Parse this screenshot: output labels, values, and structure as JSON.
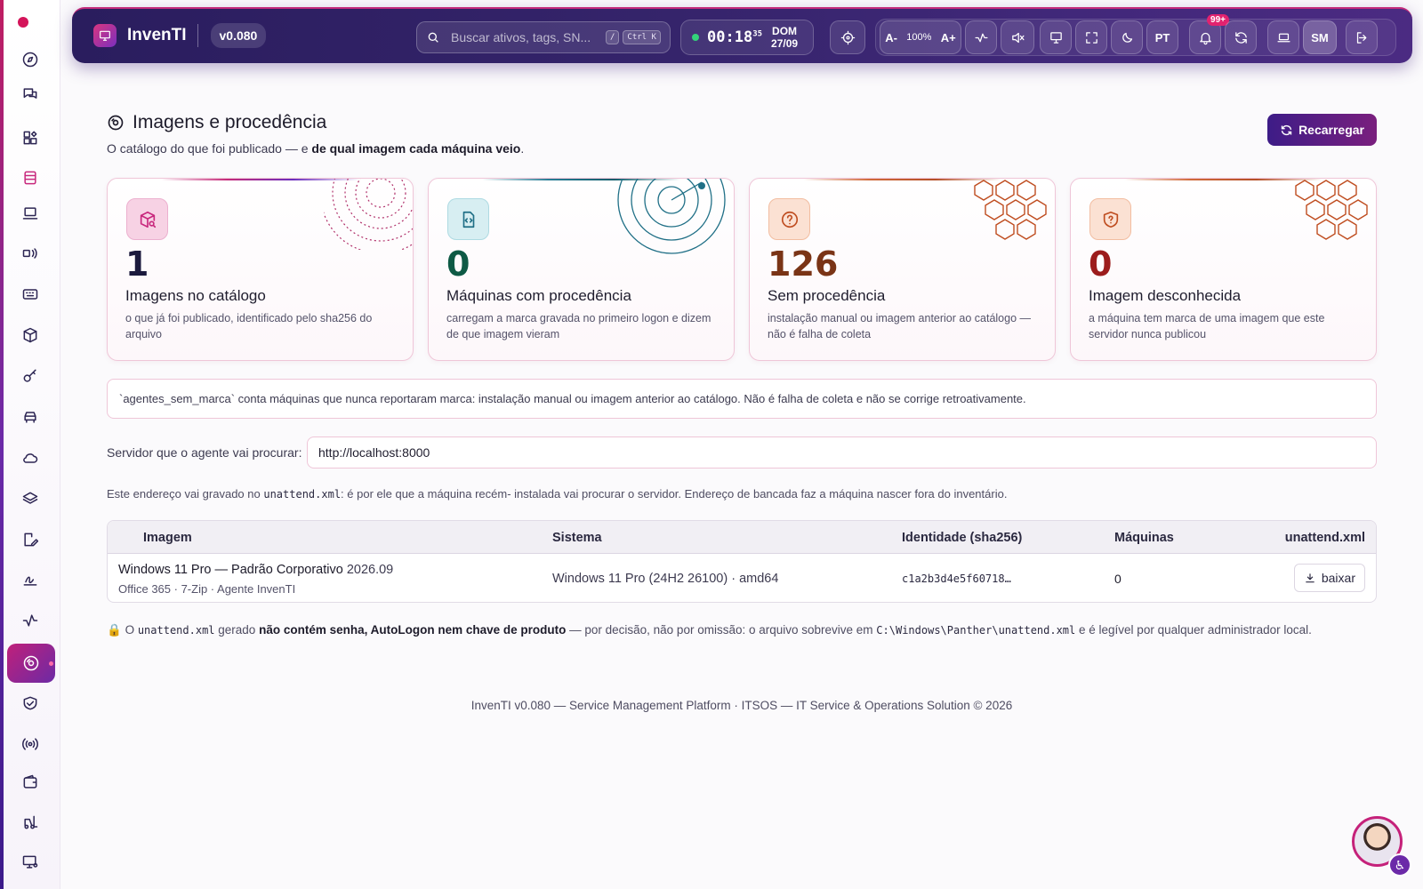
{
  "topbar": {
    "app_name": "InvenTI",
    "version": "v0.080",
    "search_placeholder": "Buscar ativos, tags, SN...",
    "search_kbd_1": "/",
    "search_kbd_2": "Ctrl K",
    "clock_time": "00:18",
    "clock_seconds": "35",
    "clock_day": "DOM",
    "clock_date": "27/09",
    "font_decrease": "A-",
    "font_zoom": "100%",
    "font_increase": "A+",
    "language": "PT",
    "notifications_badge": "99+",
    "user_initials": "SM"
  },
  "page": {
    "title": "Imagens e procedência",
    "subtitle_pre": "O catálogo do que foi publicado — e ",
    "subtitle_bold": "de qual imagem cada máquina veio",
    "subtitle_post": ".",
    "reload_label": "Recarregar"
  },
  "cards": [
    {
      "value": "1",
      "label": "Imagens no catálogo",
      "desc": "o que já foi publicado, identificado pelo sha256 do arquivo",
      "icon": "package-search-icon"
    },
    {
      "value": "0",
      "label": "Máquinas com procedência",
      "desc": "carregam a marca gravada no primeiro logon e dizem de que imagem vieram",
      "icon": "file-code-icon"
    },
    {
      "value": "126",
      "label": "Sem procedência",
      "desc": "instalação manual ou imagem anterior ao catálogo — não é falha de coleta",
      "icon": "question-circle-icon"
    },
    {
      "value": "0",
      "label": "Imagem desconhecida",
      "desc": "a máquina tem marca de uma imagem que este servidor nunca publicou",
      "icon": "shield-question-icon"
    }
  ],
  "note": "`agentes_sem_marca` conta máquinas que nunca reportaram marca: instalação manual ou imagem anterior ao catálogo. Não é falha de coleta e não se corrige retroativamente.",
  "server": {
    "label": "Servidor que o agente vai procurar:",
    "value": "http://localhost:8000",
    "help_pre": "Este endereço vai gravado no ",
    "help_code": "unattend.xml",
    "help_post": ": é por ele que a máquina recém- instalada vai procurar o servidor. Endereço de bancada faz a máquina nascer fora do inventário."
  },
  "table": {
    "headers": {
      "image": "Imagem",
      "system": "Sistema",
      "identity": "Identidade (sha256)",
      "machines": "Máquinas",
      "unattend": "unattend.xml"
    },
    "rows": [
      {
        "name": "Windows 11 Pro — Padrão Corporativo",
        "version": "2026.09",
        "apps": "Office 365 · 7-Zip · Agente InvenTI",
        "system": "Windows 11 Pro (24H2 26100) · amd64",
        "sha": "c1a2b3d4e5f60718…",
        "machines": "0",
        "download": "baixar"
      }
    ]
  },
  "lock_note": {
    "icon": "🔒",
    "pre": " O ",
    "code1": "unattend.xml",
    "mid1": " gerado ",
    "bold": "não contém senha, AutoLogon nem chave de produto",
    "mid2": " — por decisão, não por omissão: o arquivo sobrevive em ",
    "code2": "C:\\Windows\\Panther\\unattend.xml",
    "post": " e é legível por qualquer administrador local."
  },
  "footer": "InvenTI v0.080 — Service Management Platform · ITSOS — IT Service & Operations Solution © 2026",
  "colors": {
    "accent": "#3d1c87",
    "brand_pink": "#c8287d",
    "teal": "#1f6f86",
    "orange": "#bf4d20"
  }
}
